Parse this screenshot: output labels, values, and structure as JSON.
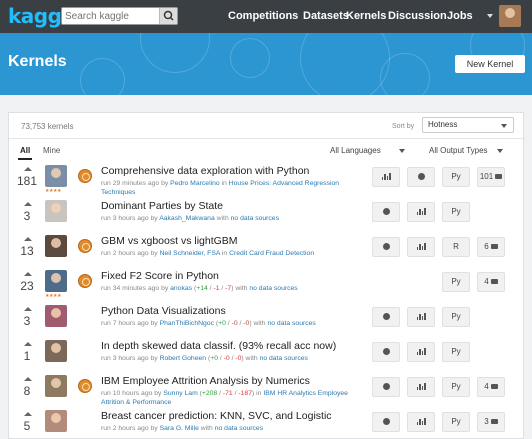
{
  "header": {
    "logo": "kaggle",
    "search_placeholder": "Search kaggle",
    "nav": [
      "Competitions",
      "Datasets",
      "Kernels",
      "Discussion",
      "Jobs"
    ]
  },
  "banner": {
    "title": "Kernels",
    "new_kernel_label": "New Kernel"
  },
  "listing": {
    "count": "73,753 kernels",
    "sort_label": "Sort by",
    "sort_value": "Hotness",
    "tabs": [
      "All",
      "Mine"
    ],
    "language_filter": "All Languages",
    "output_filter": "All Output Types"
  },
  "kernels": [
    {
      "votes": "181",
      "title": "Comprehensive data exploration with Python",
      "meta_prefix": "run 29 minutes ago by ",
      "author": "Pedro Marcelino",
      "meta_mid": " in ",
      "source": "House Prices: Advanced Regression Techniques",
      "stars": "★★★★",
      "medal": true,
      "thumb_color": "#7a8ea6",
      "badges": [
        "bar",
        "globe",
        "Py",
        "101"
      ]
    },
    {
      "votes": "3",
      "title": "Dominant Parties by State",
      "meta_prefix": "run 3 hours ago by ",
      "author": "Aakash_Makwana",
      "meta_mid": " with ",
      "source": "no data sources",
      "stars": "",
      "medal": false,
      "thumb_color": "#c9c4bd",
      "badges": [
        "globe",
        "bar",
        "Py",
        ""
      ]
    },
    {
      "votes": "13",
      "title": "GBM vs xgboost vs lightGBM",
      "meta_prefix": "run 2 hours ago by ",
      "author": "Neil Schneider, FSA",
      "meta_mid": " in ",
      "source": "Credit Card Fraud Detection",
      "stars": "",
      "medal": true,
      "thumb_color": "#5c4a3e",
      "badges": [
        "globe",
        "bar",
        "R",
        "6"
      ]
    },
    {
      "votes": "23",
      "title": "Fixed F2 Score in Python",
      "meta_prefix": "run 34 minutes ago by ",
      "author": "anokas",
      "votes_delta": [
        "+14",
        "-1",
        "-7"
      ],
      "meta_mid": " with ",
      "source": "no data sources",
      "stars": "★★★★",
      "medal": true,
      "thumb_color": "#4f6b8a",
      "badges": [
        "",
        "",
        "Py",
        "4"
      ]
    },
    {
      "votes": "3",
      "title": "Python Data Visualizations",
      "meta_prefix": "run 7 hours ago by ",
      "author": "PhanThiBichNgoc",
      "votes_delta": [
        "+0",
        "-0",
        "-0"
      ],
      "meta_mid": " with ",
      "source": "no data sources",
      "stars": "",
      "medal": false,
      "thumb_color": "#a05c6e",
      "badges": [
        "globe",
        "bar",
        "Py",
        ""
      ]
    },
    {
      "votes": "1",
      "title": "In depth skewed data classif. (93% recall acc now)",
      "meta_prefix": "run 3 hours ago by ",
      "author": "Robert Goheen",
      "votes_delta": [
        "+0",
        "-0",
        "-0"
      ],
      "meta_mid": " with ",
      "source": "no data sources",
      "stars": "",
      "medal": false,
      "thumb_color": "#7b6a5a",
      "badges": [
        "globe",
        "bar",
        "Py",
        ""
      ]
    },
    {
      "votes": "8",
      "title": "IBM Employee Attrition Analysis by Numerics",
      "meta_prefix": "run 10 hours ago by ",
      "author": "Sunny Lam",
      "votes_delta": [
        "+208",
        "-71",
        "-187"
      ],
      "meta_mid": " in ",
      "source": "IBM HR Analytics Employee Attrition & Performance",
      "stars": "",
      "medal": true,
      "thumb_color": "#8d7a60",
      "badges": [
        "globe",
        "bar",
        "Py",
        "4"
      ]
    },
    {
      "votes": "5",
      "title": "Breast cancer prediction: KNN, SVC, and Logistic",
      "meta_prefix": "run 2 hours ago by ",
      "author": "Sara G. Mille",
      "meta_mid": " with ",
      "source": "no data sources",
      "stars": "",
      "medal": false,
      "thumb_color": "#b48a7a",
      "badges": [
        "globe",
        "bar",
        "Py",
        "3"
      ]
    }
  ]
}
